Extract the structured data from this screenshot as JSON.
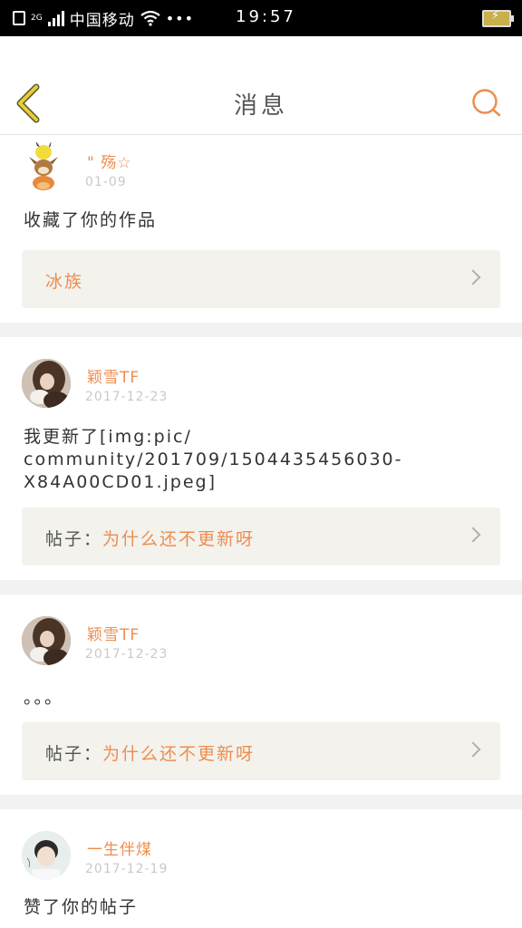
{
  "status_bar": {
    "network": "2G",
    "carrier": "中国移动",
    "dots": "•••",
    "time": "19:57",
    "battery_icon": "battery-charging-icon"
  },
  "header": {
    "title": "消息",
    "back_icon": "chevron-left-icon",
    "search_icon": "search-icon",
    "accent_color": "#ee8d4f"
  },
  "messages": [
    {
      "user": "\" 殇☆",
      "date": "01-09",
      "text": "收藏了你的作品",
      "ref_prefix": "",
      "ref_link": "冰族"
    },
    {
      "user": "颖雪TF",
      "date": "2017-12-23",
      "text": "我更新了[img:pic/\ncommunity/201709/1504435456030-\nX84A00CD01.jpeg]",
      "ref_prefix": "帖子：",
      "ref_link": "为什么还不更新呀"
    },
    {
      "user": "颖雪TF",
      "date": "2017-12-23",
      "text": "。。。",
      "ref_prefix": "帖子：",
      "ref_link": "为什么还不更新呀"
    },
    {
      "user": "一生伴煤",
      "date": "2017-12-19",
      "text": "赞了你的帖子"
    }
  ]
}
